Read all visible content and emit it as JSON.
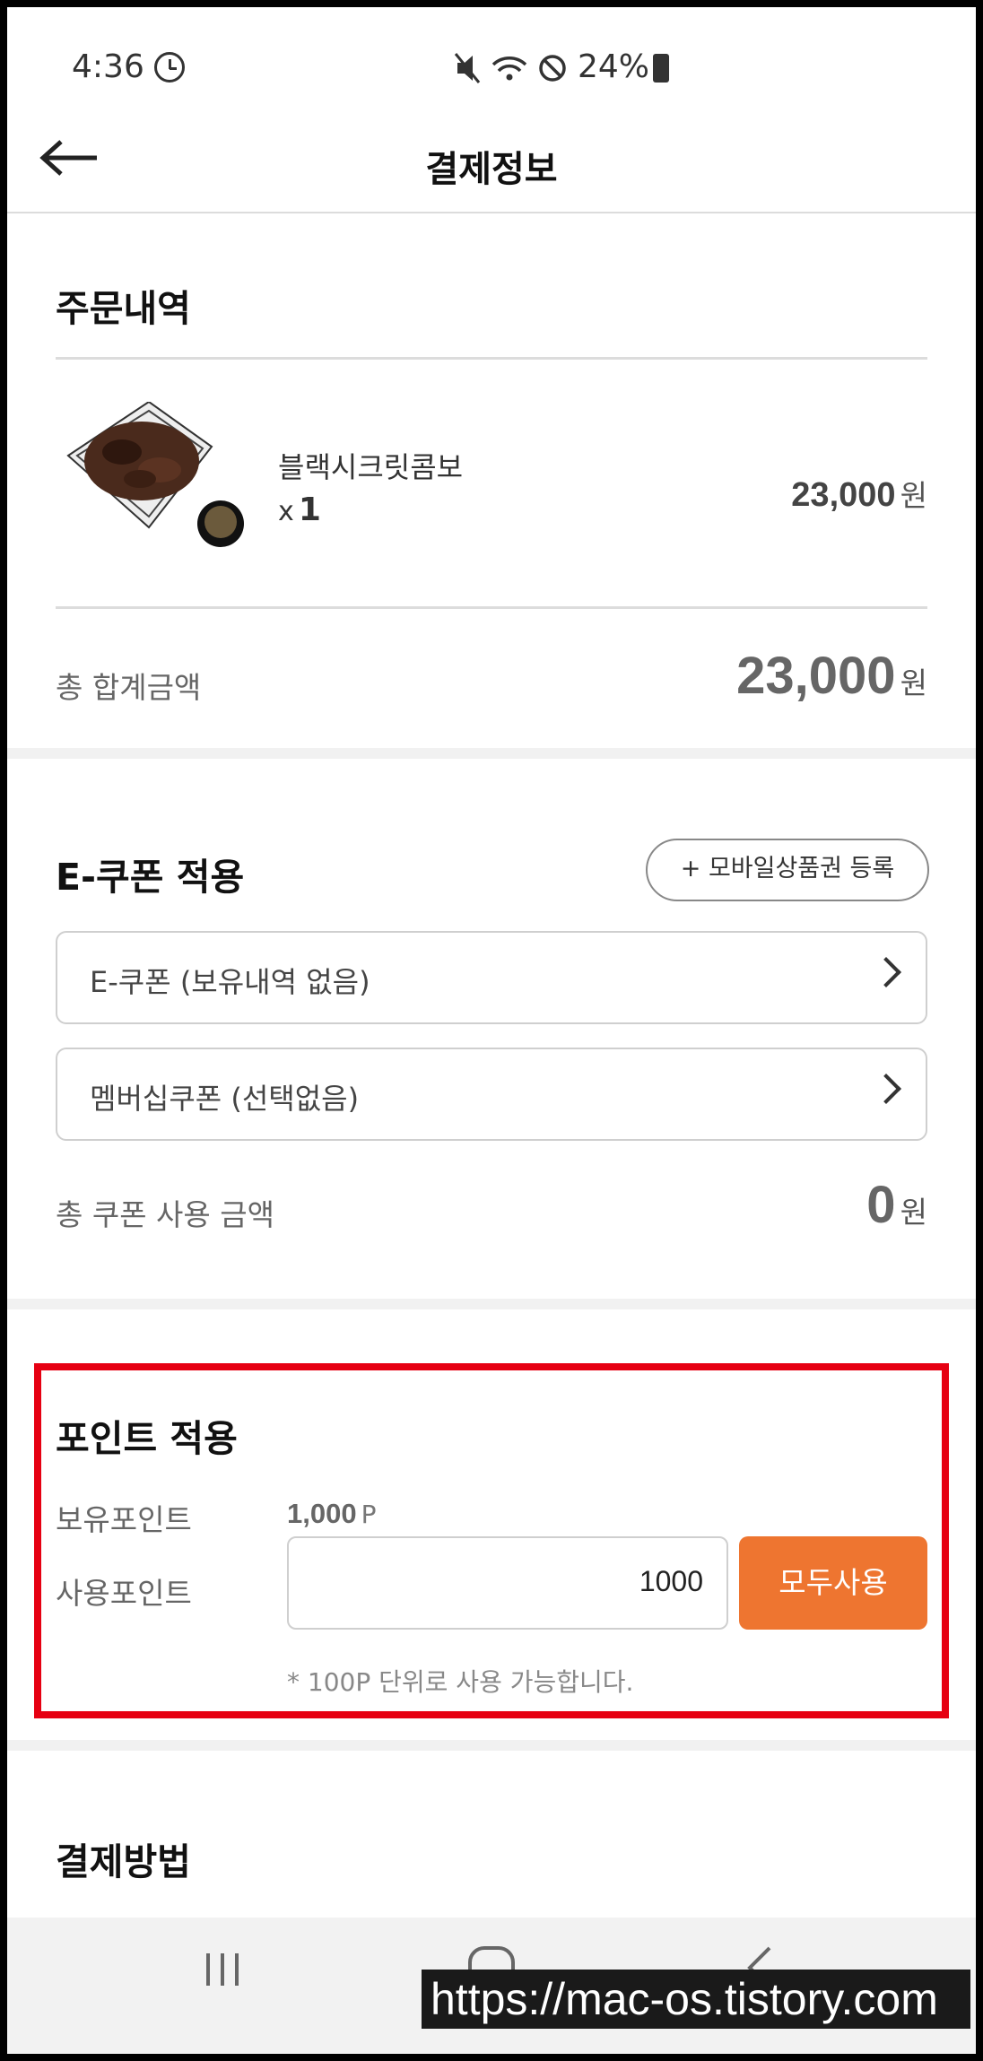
{
  "status": {
    "time": "4:36",
    "battery": "24%"
  },
  "header": {
    "title": "결제정보"
  },
  "order": {
    "section_title": "주문내역",
    "item_name": "블랙시크릿콤보",
    "item_qty_prefix": "x",
    "item_qty": "1",
    "item_price": "23,000",
    "currency": "원",
    "total_label": "총 합계금액",
    "total_value": "23,000"
  },
  "coupon": {
    "section_title": "E-쿠폰 적용",
    "register_button": "+ 모바일상품권 등록",
    "ecoupon_select": "E-쿠폰 (보유내역 없음)",
    "membership_select": "멤버십쿠폰 (선택없음)",
    "total_label": "총 쿠폰 사용 금액",
    "total_value": "0",
    "currency": "원"
  },
  "points": {
    "section_title": "포인트 적용",
    "owned_label": "보유포인트",
    "owned_value": "1,000",
    "owned_unit": "P",
    "use_label": "사용포인트",
    "use_value": "1000",
    "use_all_button": "모두사용",
    "note": "* 100P 단위로 사용 가능합니다."
  },
  "payment": {
    "section_title": "결제방법"
  },
  "watermark": "https://mac-os.tistory.com",
  "colors": {
    "accent": "#ee7530",
    "highlight": "#e60012"
  }
}
